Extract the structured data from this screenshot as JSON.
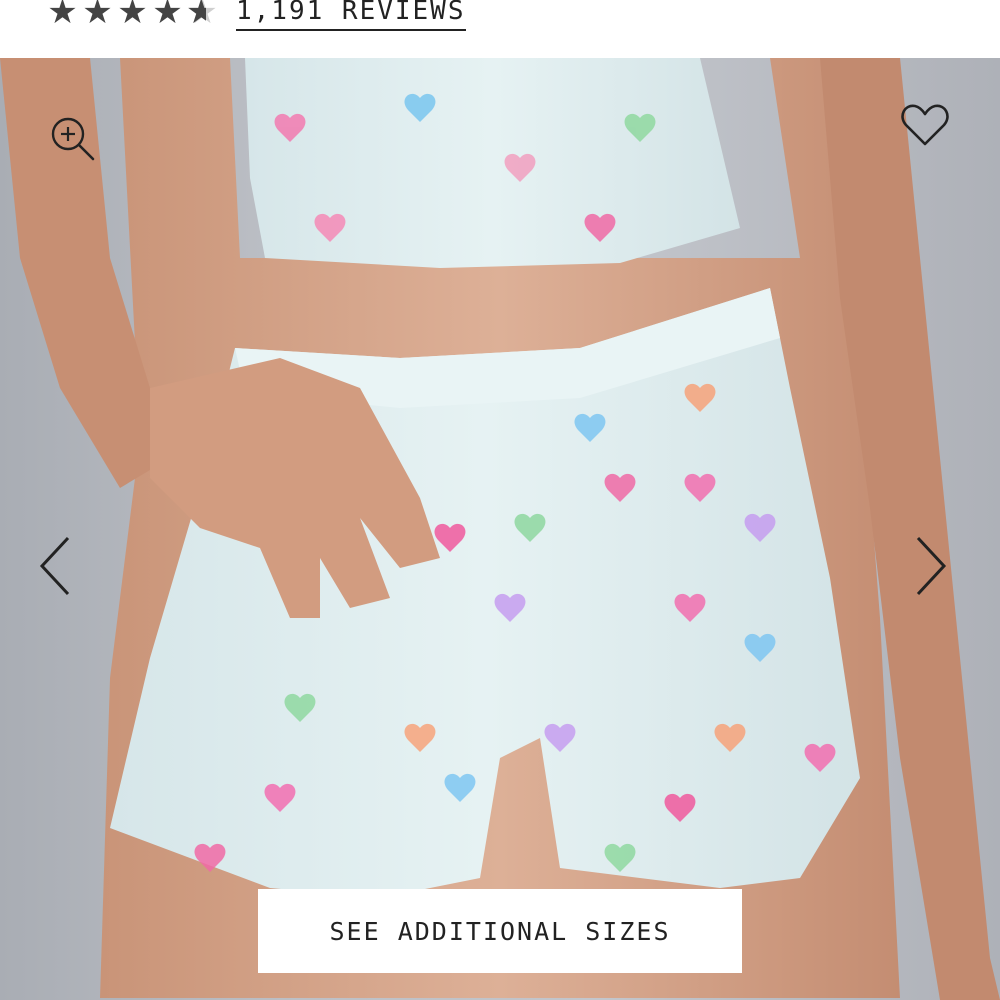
{
  "rating": {
    "value": 4.6,
    "max": 5,
    "reviews_label": "1,191 REVIEWS"
  },
  "icons": {
    "zoom": "zoom-in-icon",
    "wishlist": "heart-outline-icon",
    "prev": "chevron-left-icon",
    "next": "chevron-right-icon"
  },
  "cta": {
    "sizes_label": "SEE ADDITIONAL SIZES"
  },
  "colors": {
    "text": "#222222",
    "star": "#444444",
    "fabric": "#dfeef0",
    "background": "#ffffff"
  }
}
